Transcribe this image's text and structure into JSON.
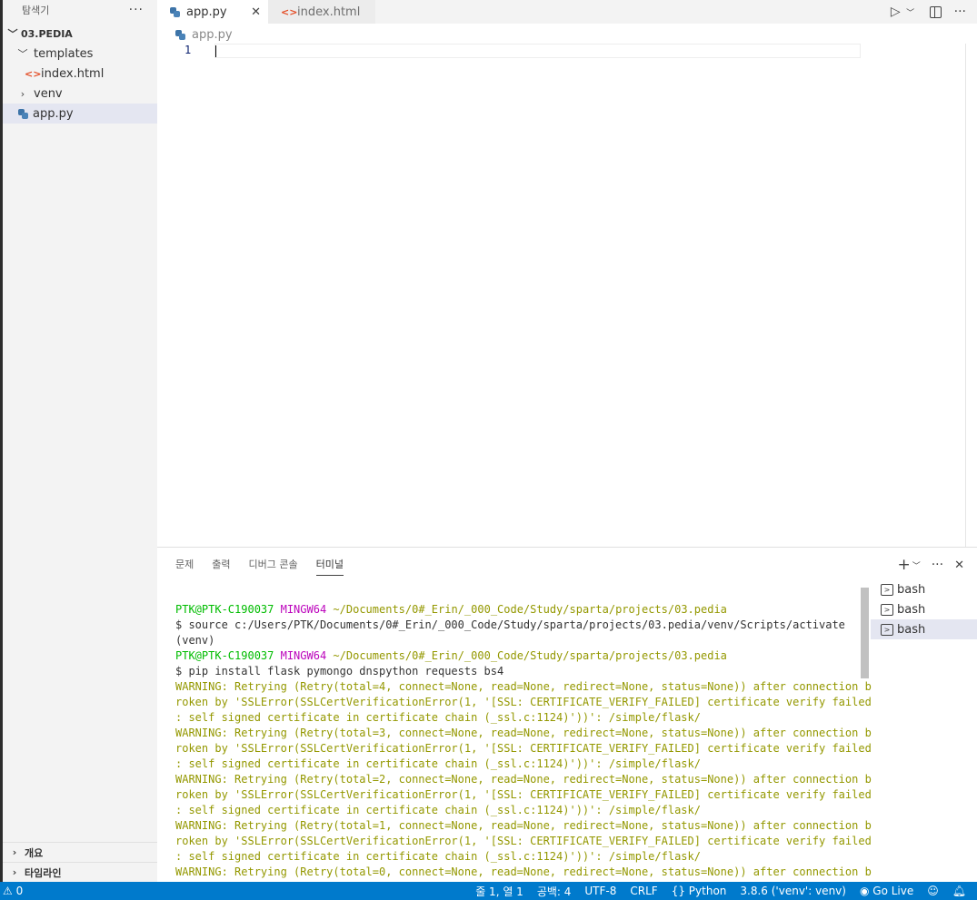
{
  "sidebar": {
    "title": "탐색기",
    "more": "···",
    "root": "03.PEDIA",
    "items": [
      {
        "label": "templates"
      },
      {
        "label": "index.html"
      },
      {
        "label": "venv"
      },
      {
        "label": "app.py"
      }
    ],
    "bottom": [
      "개요",
      "타임라인"
    ]
  },
  "tabs": [
    {
      "label": "app.py",
      "close": "✕"
    },
    {
      "label": "index.html"
    }
  ],
  "breadcrumb": "app.py",
  "editor": {
    "line_number": "1"
  },
  "panel": {
    "tabs": [
      "문제",
      "출력",
      "디버그 콘솔",
      "터미널"
    ],
    "terminals": [
      "bash",
      "bash",
      "bash"
    ]
  },
  "terminal": {
    "user1": "PTK@PTK-C190037",
    "sys1": "MINGW64",
    "path1": "~/Documents/0#_Erin/_000_Code/Study/sparta/projects/03.pedia",
    "cmd1": "$ source c:/Users/PTK/Documents/0#_Erin/_000_Code/Study/sparta/projects/03.pedia/venv/Scripts/activate",
    "venv": "(venv)",
    "user2": "PTK@PTK-C190037",
    "sys2": "MINGW64",
    "path2": "~/Documents/0#_Erin/_000_Code/Study/sparta/projects/03.pedia",
    "cmd2": "$ pip install flask pymongo dnspython requests bs4",
    "warnings": [
      "WARNING: Retrying (Retry(total=4, connect=None, read=None, redirect=None, status=None)) after connection b",
      "roken by 'SSLError(SSLCertVerificationError(1, '[SSL: CERTIFICATE_VERIFY_FAILED] certificate verify failed",
      ": self signed certificate in certificate chain (_ssl.c:1124)'))': /simple/flask/",
      "WARNING: Retrying (Retry(total=3, connect=None, read=None, redirect=None, status=None)) after connection b",
      "roken by 'SSLError(SSLCertVerificationError(1, '[SSL: CERTIFICATE_VERIFY_FAILED] certificate verify failed",
      ": self signed certificate in certificate chain (_ssl.c:1124)'))': /simple/flask/",
      "WARNING: Retrying (Retry(total=2, connect=None, read=None, redirect=None, status=None)) after connection b",
      "roken by 'SSLError(SSLCertVerificationError(1, '[SSL: CERTIFICATE_VERIFY_FAILED] certificate verify failed",
      ": self signed certificate in certificate chain (_ssl.c:1124)'))': /simple/flask/",
      "WARNING: Retrying (Retry(total=1, connect=None, read=None, redirect=None, status=None)) after connection b",
      "roken by 'SSLError(SSLCertVerificationError(1, '[SSL: CERTIFICATE_VERIFY_FAILED] certificate verify failed",
      ": self signed certificate in certificate chain (_ssl.c:1124)'))': /simple/flask/",
      "WARNING: Retrying (Retry(total=0, connect=None, read=None, redirect=None, status=None)) after connection b"
    ]
  },
  "status": {
    "problems": "⚠ 0",
    "position": "줄 1, 열 1",
    "spaces": "공백: 4",
    "encoding": "UTF-8",
    "eol": "CRLF",
    "language": "Python",
    "interpreter": "3.8.6 ('venv': venv)",
    "golive": "Go Live"
  },
  "colors": {
    "status_bar": "#007acc",
    "selection": "#e4e6f1",
    "sidebar_bg": "#f3f3f3",
    "warning_text": "#949800"
  }
}
